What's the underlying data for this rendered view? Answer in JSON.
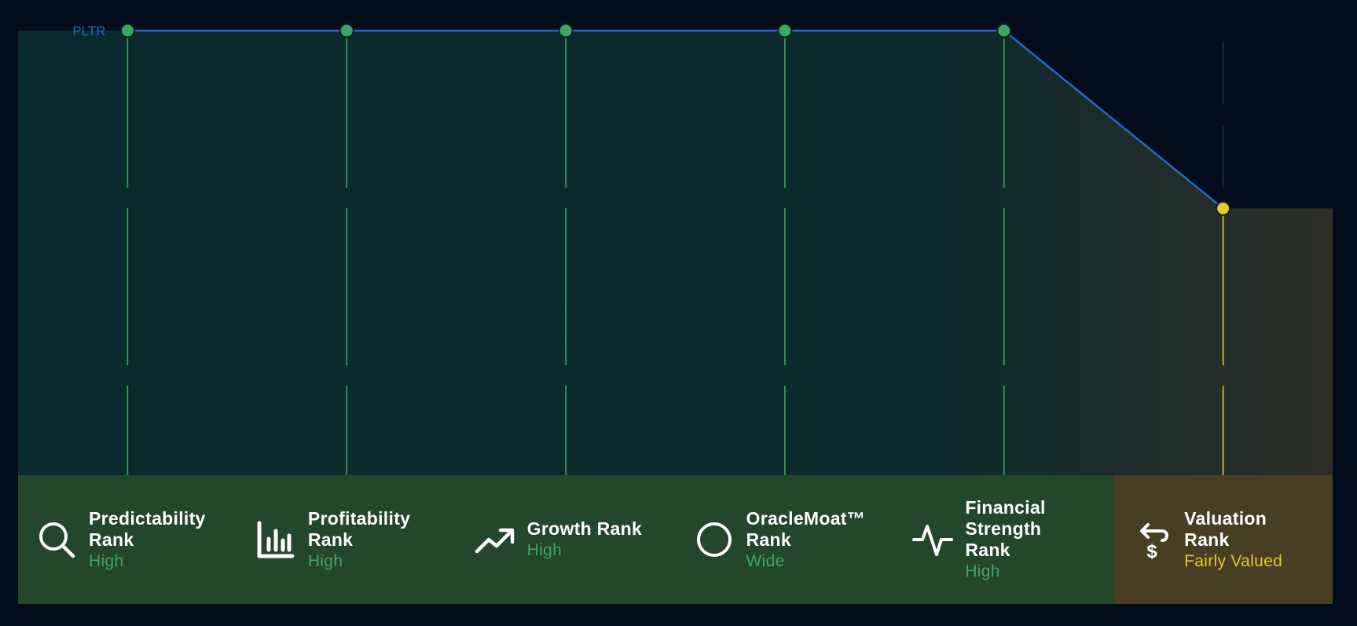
{
  "chart_data": {
    "type": "line",
    "series": [
      {
        "name": "PLTR",
        "points": [
          {
            "category": "Predictability Rank",
            "level": 1.0,
            "rating": "High"
          },
          {
            "category": "Profitability Rank",
            "level": 1.0,
            "rating": "High"
          },
          {
            "category": "Growth Rank",
            "level": 1.0,
            "rating": "High"
          },
          {
            "category": "OracleMoat™ Rank",
            "level": 1.0,
            "rating": "Wide"
          },
          {
            "category": "Financial Strength Rank",
            "level": 1.0,
            "rating": "High"
          },
          {
            "category": "Valuation Rank",
            "level": 0.6,
            "rating": "Fairly Valued"
          }
        ]
      }
    ],
    "ylim": [
      0,
      1
    ]
  },
  "ranks": [
    {
      "title": "Predictability Rank",
      "value": "High",
      "icon": "magnifier-icon"
    },
    {
      "title": "Profitability Rank",
      "value": "High",
      "icon": "bar-chart-icon"
    },
    {
      "title": "Growth Rank",
      "value": "High",
      "icon": "trend-up-icon"
    },
    {
      "title": "OracleMoat™ Rank",
      "value": "Wide",
      "icon": "circle-icon"
    },
    {
      "title": "Financial Strength Rank",
      "value": "High",
      "icon": "pulse-icon"
    },
    {
      "title": "Valuation Rank",
      "value": "Fairly Valued",
      "icon": "dollar-exchange-icon"
    }
  ],
  "colors": {
    "background": "#020c1a",
    "line": "#2469c9",
    "positive": "#3fa565",
    "neutral": "#e4c92e",
    "positive_band": "#24462a",
    "neutral_band": "#483e24"
  }
}
